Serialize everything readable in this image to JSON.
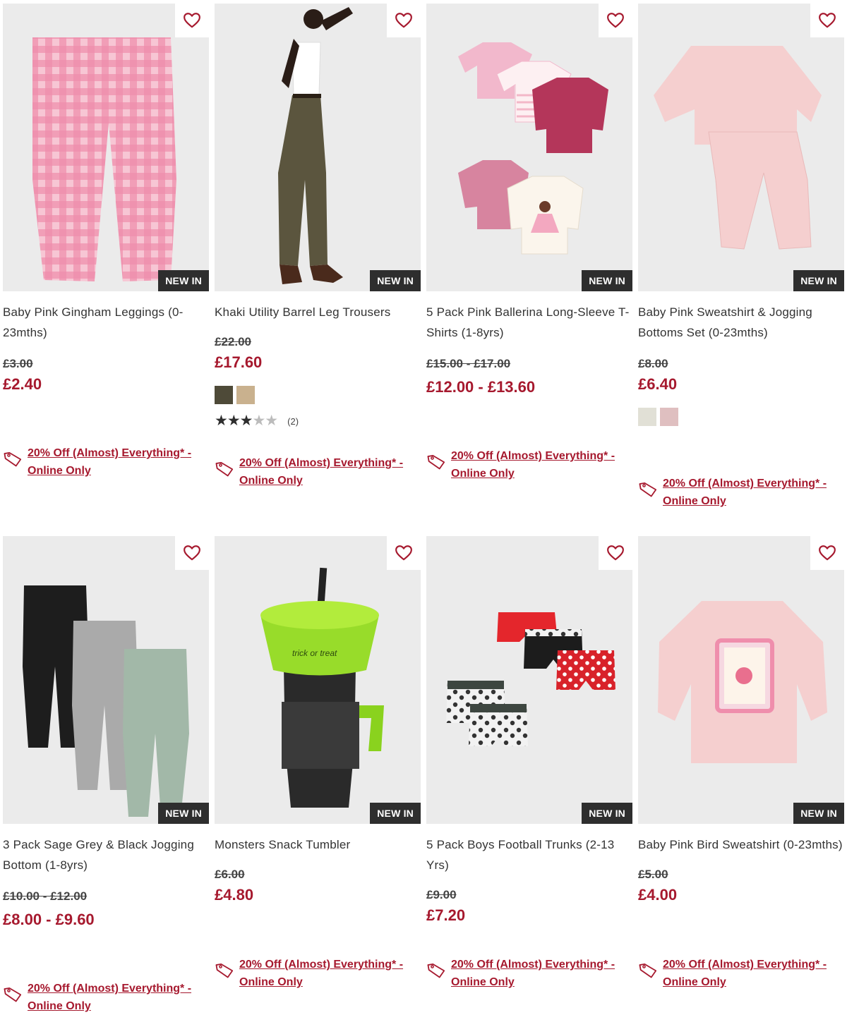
{
  "colors": {
    "accent": "#a6192e",
    "badge_bg": "#2e2e2e",
    "image_bg": "#ebebeb"
  },
  "products": [
    {
      "title": "Baby Pink Gingham Leggings (0-23mths)",
      "badge": "NEW IN",
      "was_price": "£3.00",
      "now_price": "£2.40",
      "promo": "20% Off (Almost) Everything* - Online Only",
      "swatches": [],
      "image_icon": "pink-gingham-leggings"
    },
    {
      "title": "Khaki Utility Barrel Leg Trousers",
      "badge": "NEW IN",
      "was_price": "£22.00",
      "now_price": "£17.60",
      "promo": "20% Off (Almost) Everything* - Online Only",
      "swatches": [
        "#4e4a38",
        "#c9b18e"
      ],
      "rating": {
        "value": 3,
        "max": 5,
        "count": "(2)"
      },
      "image_icon": "model-khaki-trousers"
    },
    {
      "title": "5 Pack Pink Ballerina Long-Sleeve T-Shirts (1-8yrs)",
      "badge": "NEW IN",
      "was_price": "£15.00 - £17.00",
      "now_price": "£12.00 - £13.60",
      "promo": "20% Off (Almost) Everything* - Online Only",
      "swatches": [],
      "image_icon": "ballerina-tshirts-pack"
    },
    {
      "title": "Baby Pink Sweatshirt & Jogging Bottoms Set (0-23mths)",
      "badge": "NEW IN",
      "was_price": "£8.00",
      "now_price": "£6.40",
      "promo": "20% Off (Almost) Everything* - Online Only",
      "swatches": [
        "#e1e0d6",
        "#dfbfc0"
      ],
      "image_icon": "pink-sweatshirt-set"
    },
    {
      "title": "3 Pack Sage Grey & Black Jogging Bottom (1-8yrs)",
      "badge": "NEW IN",
      "was_price": "£10.00 - £12.00",
      "now_price": "£8.00 - £9.60",
      "promo": "20% Off (Almost) Everything* - Online Only",
      "swatches": [],
      "image_icon": "jogging-bottoms-pack"
    },
    {
      "title": "Monsters Snack Tumbler",
      "badge": "NEW IN",
      "was_price": "£6.00",
      "now_price": "£4.80",
      "promo": "20% Off (Almost) Everything* - Online Only",
      "swatches": [],
      "image_icon": "snack-tumbler",
      "image_text": "trick or treat"
    },
    {
      "title": "5 Pack Boys Football Trunks (2-13 Yrs)",
      "badge": "NEW IN",
      "was_price": "£9.00",
      "now_price": "£7.20",
      "promo": "20% Off (Almost) Everything* - Online Only",
      "swatches": [],
      "image_icon": "football-trunks-pack"
    },
    {
      "title": "Baby Pink Bird Sweatshirt (0-23mths)",
      "badge": "NEW IN",
      "was_price": "£5.00",
      "now_price": "£4.00",
      "promo": "20% Off (Almost) Everything* - Online Only",
      "swatches": [],
      "image_icon": "pink-bird-sweatshirt"
    }
  ]
}
